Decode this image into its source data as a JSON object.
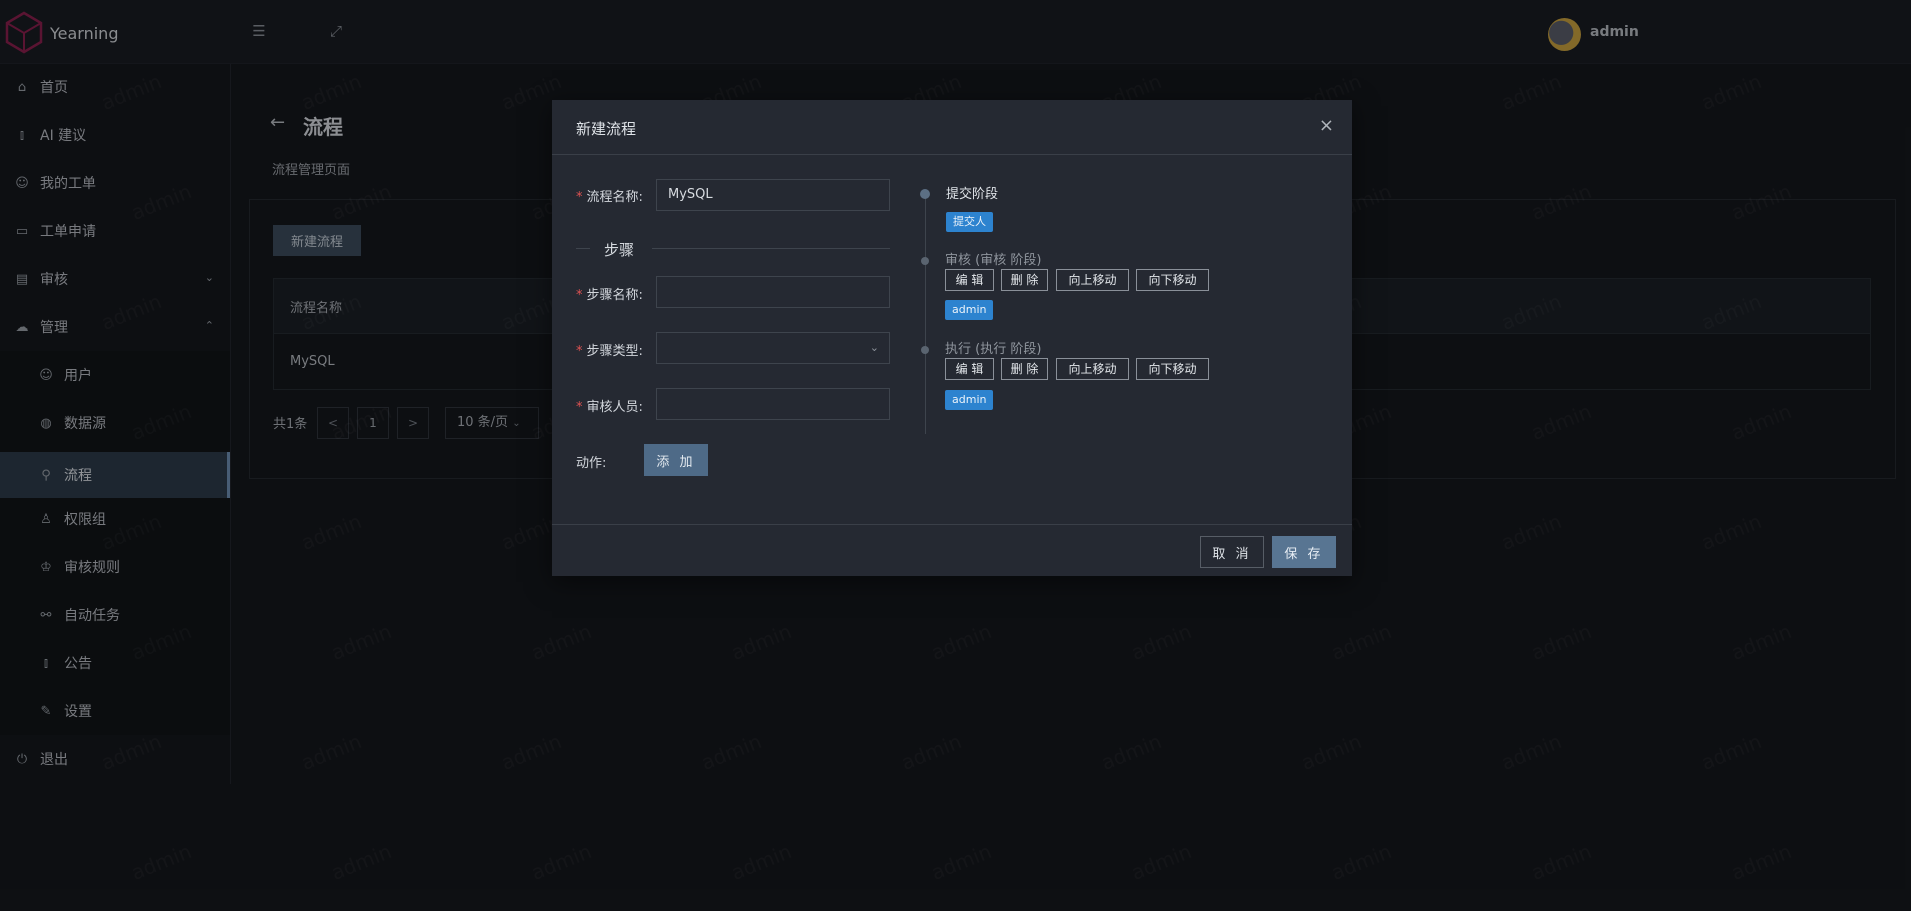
{
  "app": {
    "name": "Yearning",
    "user": "admin",
    "watermark": "admin"
  },
  "sidebar": {
    "items": [
      {
        "label": "首页",
        "icon": "home-icon"
      },
      {
        "label": "AI 建议",
        "icon": "chart-icon"
      },
      {
        "label": "我的工单",
        "icon": "user-icon"
      },
      {
        "label": "工单申请",
        "icon": "monitor-icon"
      },
      {
        "label": "审核",
        "icon": "audit-icon"
      },
      {
        "label": "管理",
        "icon": "cloud-icon"
      },
      {
        "label": "用户",
        "icon": "user-icon"
      },
      {
        "label": "数据源",
        "icon": "database-icon"
      },
      {
        "label": "流程",
        "icon": "flow-icon"
      },
      {
        "label": "权限组",
        "icon": "group-icon"
      },
      {
        "label": "审核规则",
        "icon": "rule-icon"
      },
      {
        "label": "自动任务",
        "icon": "paperclip-icon"
      },
      {
        "label": "公告",
        "icon": "chart-icon"
      },
      {
        "label": "设置",
        "icon": "wrench-icon"
      },
      {
        "label": "退出",
        "icon": "logout-icon"
      }
    ],
    "active": "流程"
  },
  "page": {
    "title": "流程",
    "subtitle": "流程管理页面",
    "new_button": "新建流程",
    "table": {
      "header": "流程名称",
      "rows": [
        "MySQL"
      ]
    },
    "pager": {
      "total": "共1条",
      "prev": "<",
      "page": "1",
      "next": ">",
      "size": "10 条/页"
    }
  },
  "modal": {
    "title": "新建流程",
    "close": "×",
    "fields": {
      "flow_name_label": "流程名称:",
      "flow_name_value": "MySQL",
      "steps_divider": "步骤",
      "step_name_label": "步骤名称:",
      "step_type_label": "步骤类型:",
      "auditor_label": "审核人员:",
      "action_label": "动作:",
      "add_button": "添 加"
    },
    "timeline": {
      "submit": {
        "title": "提交阶段",
        "tag": "提交人"
      },
      "audit": {
        "title": "审核 (审核 阶段)",
        "tag": "admin"
      },
      "execute": {
        "title": "执行 (执行 阶段)",
        "tag": "admin"
      },
      "buttons": {
        "edit": "编 辑",
        "delete": "删 除",
        "up": "向上移动",
        "down": "向下移动"
      }
    },
    "footer": {
      "cancel": "取 消",
      "save": "保 存"
    }
  }
}
